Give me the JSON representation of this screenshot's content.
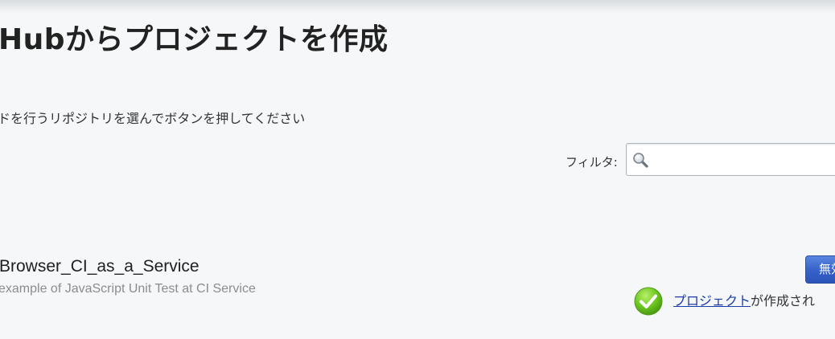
{
  "header": {
    "title": "Hubからプロジェクトを作成"
  },
  "instruction": {
    "text": "ドを行うリポジトリを選んでボタンを押してください"
  },
  "filter": {
    "label": "フィルタ:",
    "value": "",
    "placeholder": "",
    "icon": "search-icon"
  },
  "repositories": [
    {
      "name": "Browser_CI_as_a_Service",
      "description": "example of JavaScript Unit Test at CI Service",
      "button_label": "無効",
      "status": {
        "icon": "check-circle-icon",
        "link_text": "プロジェクト",
        "suffix_text": "が作成され"
      }
    }
  ],
  "colors": {
    "background": "#f5f7f8",
    "button": "#3561c9",
    "link": "#1a3ca8",
    "success": "#6cc620"
  }
}
